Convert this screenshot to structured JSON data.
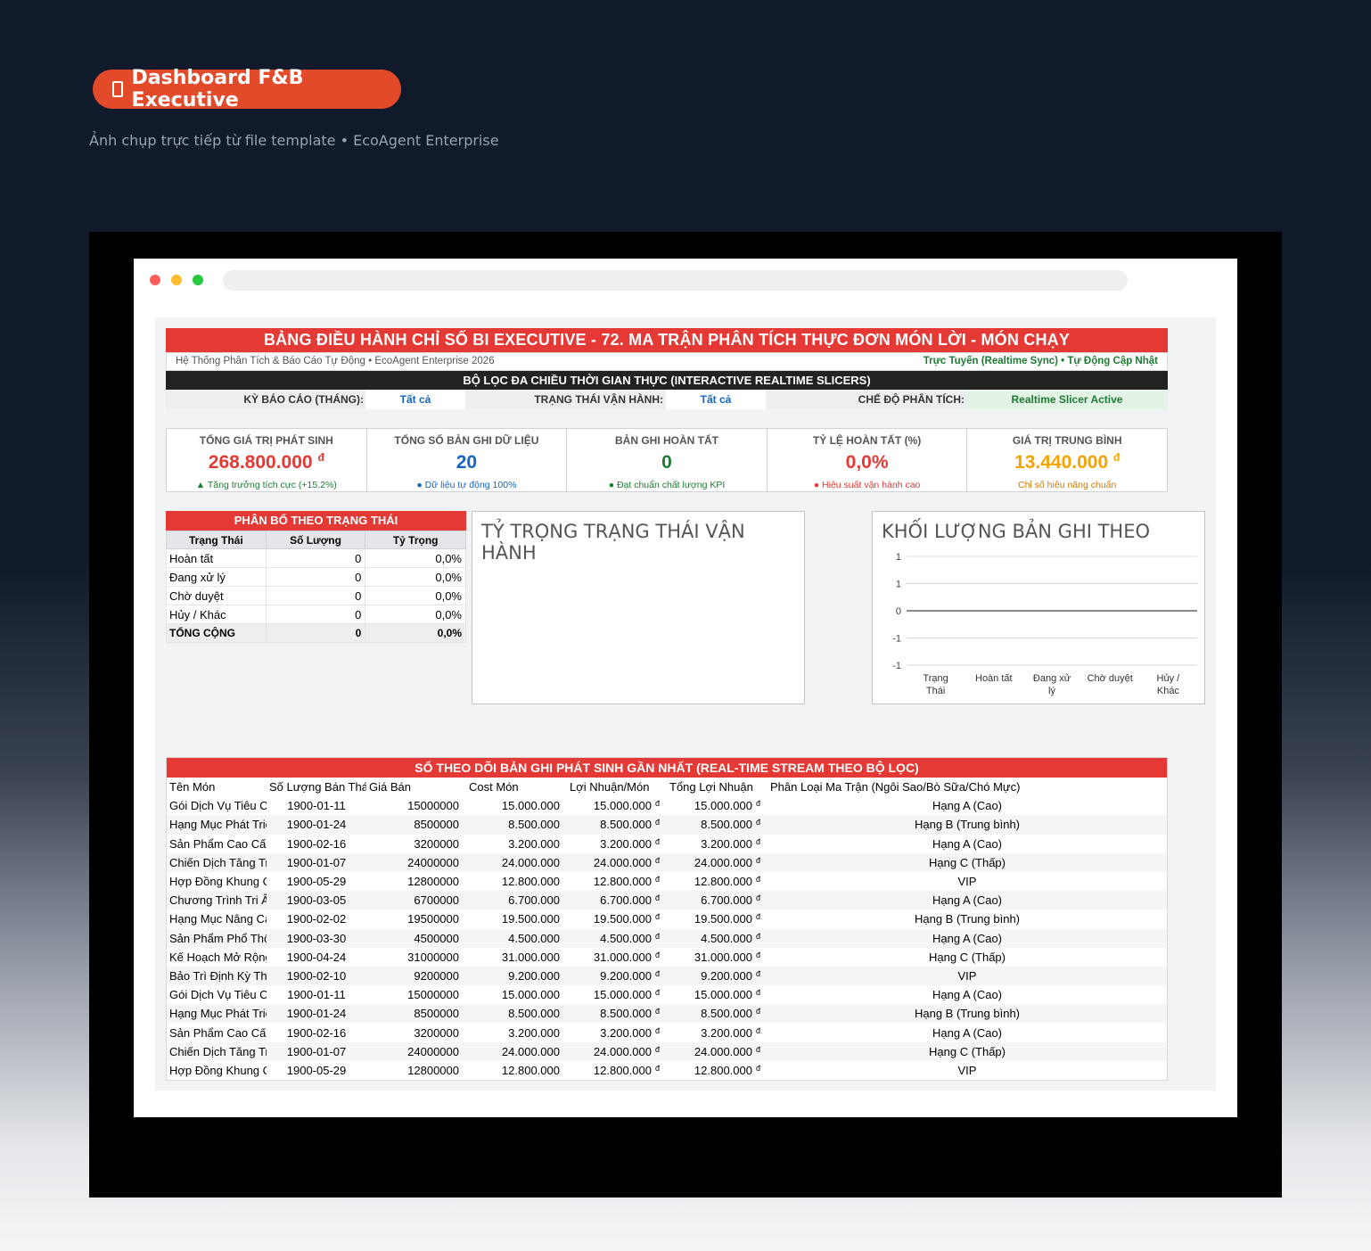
{
  "hero": {
    "title": "Dashboard F&B Executive",
    "subtitle": "Ảnh chụp trực tiếp từ file template • EcoAgent Enterprise"
  },
  "dashboard": {
    "title": "BẢNG ĐIỀU HÀNH CHỈ SỐ BI EXECUTIVE - 72. MA TRẬN PHÂN TÍCH THỰC ĐƠN MÓN LỜI - MÓN CHẠY",
    "system_line": "Hệ Thống Phân Tích & Báo Cáo Tự Động • EcoAgent Enterprise 2026",
    "sync_status": "Trực Tuyến (Realtime Sync) • Tự Động Cập Nhật"
  },
  "slicers": {
    "title": "BỘ LỌC ĐA CHIỀU THỜI GIAN THỰC (INTERACTIVE REALTIME SLICERS)",
    "period_label": "KỲ BÁO CÁO (THÁNG):",
    "period_value": "Tất cả",
    "status_label": "TRẠNG THÁI VẬN HÀNH:",
    "status_value": "Tất cả",
    "mode_label": "CHẾ ĐỘ PHÂN TÍCH:",
    "mode_value": "Realtime Slicer Active"
  },
  "kpis": [
    {
      "label": "TỔNG GIÁ TRỊ PHÁT SINH",
      "value": "268.800.000",
      "unit": "đ",
      "note": "▲ Tăng trưởng tích cực (+15.2%)",
      "color": "#e53935",
      "note_color": "#1e7b34"
    },
    {
      "label": "TỔNG SỐ BẢN GHI DỮ LIỆU",
      "value": "20",
      "unit": "",
      "note": "● Dữ liệu tự động 100%",
      "color": "#1565c0",
      "note_color": "#1565c0"
    },
    {
      "label": "BẢN GHI HOÀN TẤT",
      "value": "0",
      "unit": "",
      "note": "● Đạt chuẩn chất lượng KPI",
      "color": "#1e7b34",
      "note_color": "#1e7b34"
    },
    {
      "label": "TỶ LỆ HOÀN TẤT (%)",
      "value": "0,0%",
      "unit": "",
      "note": "● Hiệu suất vận hành cao",
      "color": "#e53935",
      "note_color": "#e53935"
    },
    {
      "label": "GIÁ TRỊ TRUNG BÌNH",
      "value": "13.440.000",
      "unit": "đ",
      "note": "Chỉ số hiệu năng chuẩn",
      "color": "#f4a300",
      "note_color": "#d07a00"
    }
  ],
  "status_table": {
    "title": "PHÂN BỔ THEO TRẠNG THÁI",
    "columns": [
      "Trạng Thái",
      "Số Lượng",
      "Tỷ Trọng"
    ],
    "rows": [
      [
        "Hoàn tất",
        "0",
        "0,0%"
      ],
      [
        "Đang xử lý",
        "0",
        "0,0%"
      ],
      [
        "Chờ duyệt",
        "0",
        "0,0%"
      ],
      [
        "Hủy / Khác",
        "0",
        "0,0%"
      ]
    ],
    "total": [
      "TỔNG CỘNG",
      "0",
      "0,0%"
    ]
  },
  "pie_chart": {
    "title": "TỶ TRỌNG TRẠNG THÁI VẬN HÀNH"
  },
  "chart_data": {
    "type": "bar",
    "title": "KHỐI LƯỢNG BẢN GHI THEO",
    "categories": [
      "Trạng Thái",
      "Hoàn tất",
      "Đang xử lý",
      "Chờ duyệt",
      "Hủy / Khác"
    ],
    "values": [
      0,
      0,
      0,
      0,
      0
    ],
    "ytick_labels": [
      "1",
      "1",
      "0",
      "-1",
      "-1"
    ],
    "ylim": [
      -1,
      1
    ],
    "grid": true
  },
  "log": {
    "title": "SỔ THEO DÕI BẢN GHI PHÁT SINH GẦN NHẤT (REAL-TIME STREAM THEO BỘ LỌC)",
    "columns": [
      "Tên Món",
      "Số Lượng Bán Tháng",
      "Giá Bán",
      "Cost Món",
      "Lợi Nhuận/Món",
      "Tổng Lợi Nhuận",
      "Phân Loại Ma Trận (Ngôi Sao/Bò Sữa/Chó Mực)"
    ],
    "currency": "đ",
    "rows": [
      [
        "Gói Dịch Vụ Tiêu Chuẩn",
        "1900-01-11",
        "15000000",
        "15.000.000",
        "15.000.000",
        "15.000.000",
        "Hạng A (Cao)"
      ],
      [
        "Hạng Mục Phát Triển",
        "1900-01-24",
        "8500000",
        "8.500.000",
        "8.500.000",
        "8.500.000",
        "Hạng B (Trung bình)"
      ],
      [
        "Sản Phẩm Cao Cấp",
        "1900-02-16",
        "3200000",
        "3.200.000",
        "3.200.000",
        "3.200.000",
        "Hạng A (Cao)"
      ],
      [
        "Chiến Dịch Tăng Trưởng",
        "1900-01-07",
        "24000000",
        "24.000.000",
        "24.000.000",
        "24.000.000",
        "Hạng C (Thấp)"
      ],
      [
        "Hợp Đồng Khung Chiến Lược",
        "1900-05-29",
        "12800000",
        "12.800.000",
        "12.800.000",
        "12.800.000",
        "VIP"
      ],
      [
        "Chương Trình Tri Ân",
        "1900-03-05",
        "6700000",
        "6.700.000",
        "6.700.000",
        "6.700.000",
        "Hạng A (Cao)"
      ],
      [
        "Hạng Mục Nâng Cấp",
        "1900-02-02",
        "19500000",
        "19.500.000",
        "19.500.000",
        "19.500.000",
        "Hạng B (Trung bình)"
      ],
      [
        "Sản Phẩm Phổ Thông",
        "1900-03-30",
        "4500000",
        "4.500.000",
        "4.500.000",
        "4.500.000",
        "Hạng A (Cao)"
      ],
      [
        "Kế Hoạch Mở Rộng",
        "1900-04-24",
        "31000000",
        "31.000.000",
        "31.000.000",
        "31.000.000",
        "Hạng C (Thấp)"
      ],
      [
        "Bảo Trì Định Kỳ Thường Niên",
        "1900-02-10",
        "9200000",
        "9.200.000",
        "9.200.000",
        "9.200.000",
        "VIP"
      ],
      [
        "Gói Dịch Vụ Tiêu Chuẩn",
        "1900-01-11",
        "15000000",
        "15.000.000",
        "15.000.000",
        "15.000.000",
        "Hạng A (Cao)"
      ],
      [
        "Hạng Mục Phát Triển",
        "1900-01-24",
        "8500000",
        "8.500.000",
        "8.500.000",
        "8.500.000",
        "Hạng B (Trung bình)"
      ],
      [
        "Sản Phẩm Cao Cấp",
        "1900-02-16",
        "3200000",
        "3.200.000",
        "3.200.000",
        "3.200.000",
        "Hạng A (Cao)"
      ],
      [
        "Chiến Dịch Tăng Trưởng",
        "1900-01-07",
        "24000000",
        "24.000.000",
        "24.000.000",
        "24.000.000",
        "Hạng C (Thấp)"
      ],
      [
        "Hợp Đồng Khung Chiến Lược",
        "1900-05-29",
        "12800000",
        "12.800.000",
        "12.800.000",
        "12.800.000",
        "VIP"
      ]
    ]
  }
}
